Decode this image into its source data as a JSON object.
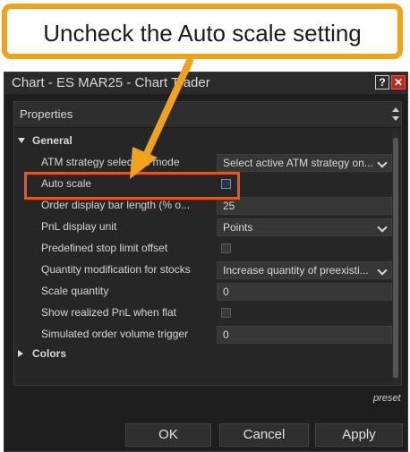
{
  "annotation": {
    "callout_text": "Uncheck the Auto scale setting",
    "accent_color": "#f0a21a",
    "highlight_color": "#e8571d"
  },
  "window": {
    "title": "Chart - ES MAR25 - Chart Trader",
    "help_label": "?",
    "close_label": "✕"
  },
  "properties": {
    "header_label": "Properties",
    "sections": {
      "general": "General",
      "colors": "Colors"
    },
    "rows": [
      {
        "label": "ATM strategy selection mode",
        "value": "Select active ATM strategy on...",
        "type": "dropdown"
      },
      {
        "label": "Auto scale",
        "value": "",
        "type": "checkbox"
      },
      {
        "label": "Order display bar length (% o...",
        "value": "25",
        "type": "text"
      },
      {
        "label": "PnL display unit",
        "value": "Points",
        "type": "dropdown"
      },
      {
        "label": "Predefined stop limit offset",
        "value": "",
        "type": "checkbox"
      },
      {
        "label": "Quantity modification for stocks",
        "value": "Increase quantity of preexisti...",
        "type": "dropdown"
      },
      {
        "label": "Scale quantity",
        "value": "0",
        "type": "text"
      },
      {
        "label": "Show realized PnL when flat",
        "value": "",
        "type": "checkbox"
      },
      {
        "label": "Simulated order volume trigger",
        "value": "0",
        "type": "text"
      }
    ]
  },
  "footer": {
    "preset_label": "preset",
    "ok_label": "OK",
    "cancel_label": "Cancel",
    "apply_label": "Apply"
  }
}
